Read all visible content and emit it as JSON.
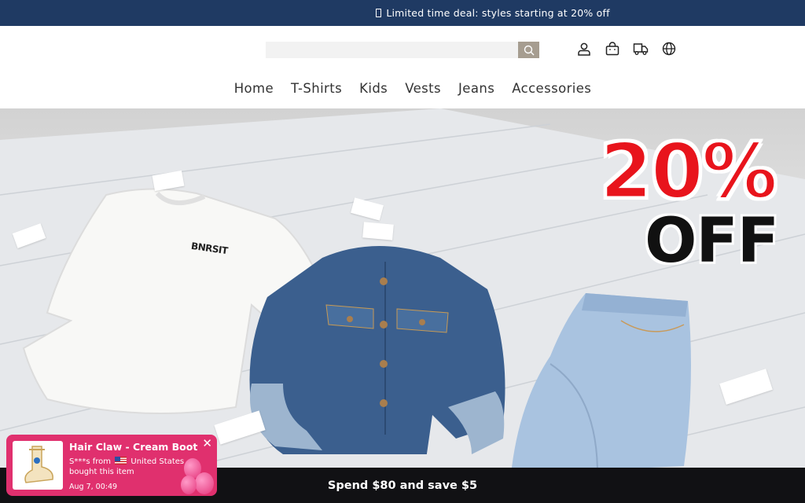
{
  "announcement": {
    "icon": "square-glyph-icon",
    "text": "Limited time deal: styles starting at 20% off"
  },
  "header": {
    "search": {
      "value": "",
      "placeholder": "",
      "button_icon": "search-icon"
    },
    "icons": [
      "account-icon",
      "cart-icon",
      "shipping-icon",
      "globe-icon"
    ]
  },
  "nav": {
    "items": [
      "Home",
      "T-Shirts",
      "Kids",
      "Vests",
      "Jeans",
      "Accessories"
    ]
  },
  "hero": {
    "promo_percent": "20%",
    "promo_off": "OFF",
    "tshirt_print": "BNRSIT",
    "colors": {
      "promo_red": "#e8141c",
      "denim_dark": "#3a5f8f",
      "denim_light": "#a9c3e0"
    }
  },
  "bottom_bar": {
    "text": "Spend $80 and save $5"
  },
  "popup": {
    "product": "Hair Claw - Cream Boot",
    "buyer_prefix": "S***s from",
    "country": "United States",
    "action": "bought this item",
    "time": "Aug 7, 00:49",
    "close_label": "✕",
    "color": "#e0306e"
  }
}
